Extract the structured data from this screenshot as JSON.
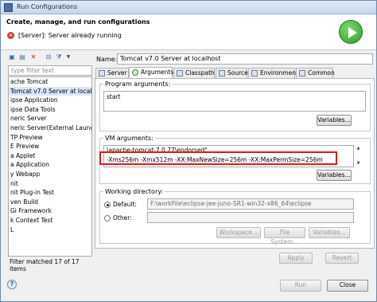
{
  "window": {
    "title": "Run Configurations"
  },
  "header": {
    "heading": "Create, manage, and run configurations",
    "message": "[Server]: Server already running"
  },
  "left": {
    "filter_placeholder": "type filter text",
    "tree_items": [
      {
        "label": "ache Tomcat",
        "selected": false
      },
      {
        "label": "Tomcat v7.0 Server at localho",
        "selected": true
      },
      {
        "label": "ipse Application",
        "selected": false
      },
      {
        "label": "ipse Data Tools",
        "selected": false
      },
      {
        "label": "neric Server",
        "selected": false
      },
      {
        "label": "neric Server(External Launch)",
        "selected": false
      },
      {
        "label": "TP Preview",
        "selected": false
      },
      {
        "label": "E Preview",
        "selected": false
      },
      {
        "label": "a Applet",
        "selected": false
      },
      {
        "label": "a Application",
        "selected": false
      },
      {
        "label": "y Webapp",
        "selected": false
      },
      {
        "label": "nit",
        "selected": false
      },
      {
        "label": "nit Plug-in Test",
        "selected": false
      },
      {
        "label": "ven Build",
        "selected": false
      },
      {
        "label": "Gi Framework",
        "selected": false
      },
      {
        "label": "k Context Test",
        "selected": false
      },
      {
        "label": "L",
        "selected": false
      }
    ],
    "filter_status": "Filter matched 17 of 17 items"
  },
  "right": {
    "name_label": "Name:",
    "name_value": "Tomcat v7.0 Server at localhost",
    "tabs": [
      {
        "label": "Server",
        "active": false
      },
      {
        "label": "Arguments",
        "active": true
      },
      {
        "label": "Classpath",
        "active": false
      },
      {
        "label": "Source",
        "active": false
      },
      {
        "label": "Environment",
        "active": false
      },
      {
        "label": "Common",
        "active": false
      }
    ],
    "program_args": {
      "label": "Program arguments:",
      "value": "start",
      "variables_btn": "Variables..."
    },
    "vm_args": {
      "label": "VM arguments:",
      "line1": "\\apache-tomcat-7.0.77\\endorsed\"",
      "line2": "-Xms256m -Xmx512m -XX:MaxNewSize=256m -XX:MaxPermSize=256m",
      "variables_btn": "Variables..."
    },
    "working_dir": {
      "label": "Working directory:",
      "default_label": "Default:",
      "default_value": "F:\\workFile\\eclipse-jee-juno-SR1-win32-x86_64\\eclipse",
      "other_label": "Other:",
      "workspace_btn": "Workspace...",
      "filesystem_btn": "File System...",
      "variables_btn": "Variables..."
    },
    "apply_btn": "Apply",
    "revert_btn": "Revert"
  },
  "footer": {
    "help": "?",
    "run_btn": "Run",
    "close_btn": "Close"
  }
}
